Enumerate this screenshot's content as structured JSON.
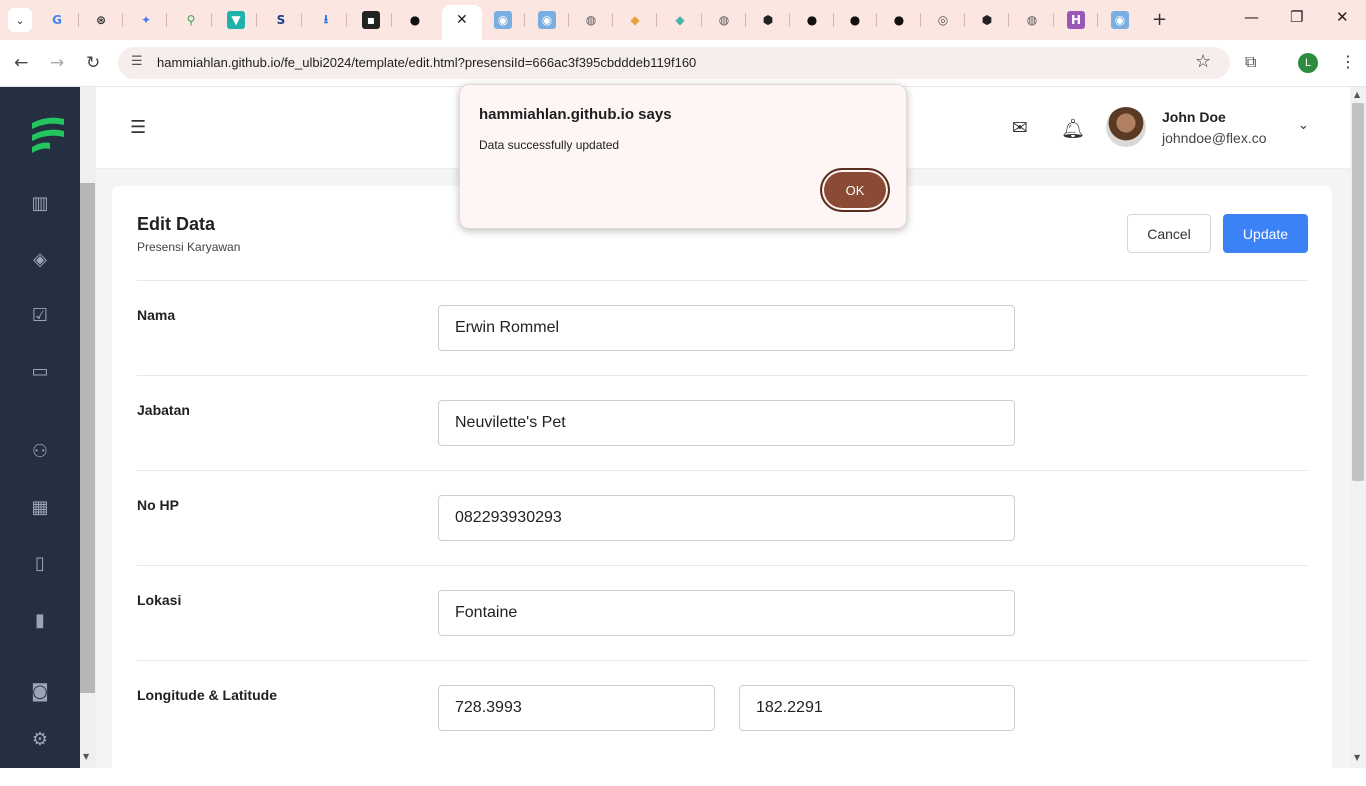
{
  "browser": {
    "url": "hammiahlan.github.io/fe_ulbi2024/template/edit.html?presensiId=666ac3f395cbdddeb119f160",
    "profile_initial": "L",
    "tab_icons": [
      "google-icon",
      "chatgpt-icon",
      "gemini-icon",
      "maps-icon",
      "vpn-icon",
      "s-icon",
      "download-icon",
      "dark-app-icon",
      "github-icon",
      "active-tab",
      "app-icon",
      "app-icon",
      "globe-icon",
      "stack-icon",
      "stack-icon",
      "globe-icon",
      "cube-icon",
      "github-icon",
      "github-icon",
      "github-icon",
      "chrome-icon",
      "cube-icon",
      "globe-icon",
      "h-icon",
      "app-icon"
    ]
  },
  "header": {
    "user_name": "John Doe",
    "user_email": "johndoe@flex.co"
  },
  "card": {
    "title": "Edit Data",
    "subtitle": "Presensi Karyawan",
    "cancel_label": "Cancel",
    "update_label": "Update"
  },
  "fields": {
    "nama_label": "Nama",
    "nama_value": "Erwin Rommel",
    "jabatan_label": "Jabatan",
    "jabatan_value": "Neuvilette's Pet",
    "nohp_label": "No HP",
    "nohp_value": "082293930293",
    "lokasi_label": "Lokasi",
    "lokasi_value": "Fontaine",
    "lonlat_label": "Longitude & Latitude",
    "longitude_value": "728.3993",
    "latitude_value": "182.2291"
  },
  "dialog": {
    "title": "hammiahlan.github.io says",
    "message": "Data successfully updated",
    "ok_label": "OK"
  },
  "colors": {
    "sidebar": "#243040",
    "accent": "#3b82f6",
    "dialog_ok": "#8a4a34",
    "logo": "#22c55e"
  }
}
